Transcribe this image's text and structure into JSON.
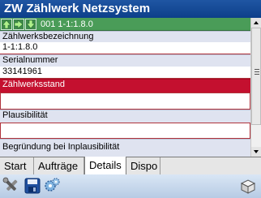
{
  "window": {
    "title": "ZW Zählwerk Netzsystem"
  },
  "nav": {
    "record": "001 1-1:1.8.0"
  },
  "fields": {
    "bezeichnung_label": "Zählwerksbezeichnung",
    "bezeichnung_value": "1-1:1.8.0",
    "serial_label": "Serialnummer",
    "serial_value": "33141961",
    "stand_label": "Zählwerksstand",
    "stand_value": "",
    "plausibilitaet_label": "Plausibilität",
    "plausibilitaet_value": "",
    "begruendung_label": "Begründung bei Inplausibilität"
  },
  "tabs": [
    {
      "label": "Start"
    },
    {
      "label": "Aufträge"
    },
    {
      "label": "Details"
    },
    {
      "label": "Dispo"
    }
  ],
  "active_tab": "Details",
  "toolbar": {
    "icons": [
      "tools-icon",
      "save-disk-icon",
      "settings-gears-icon",
      "box-icon"
    ]
  }
}
